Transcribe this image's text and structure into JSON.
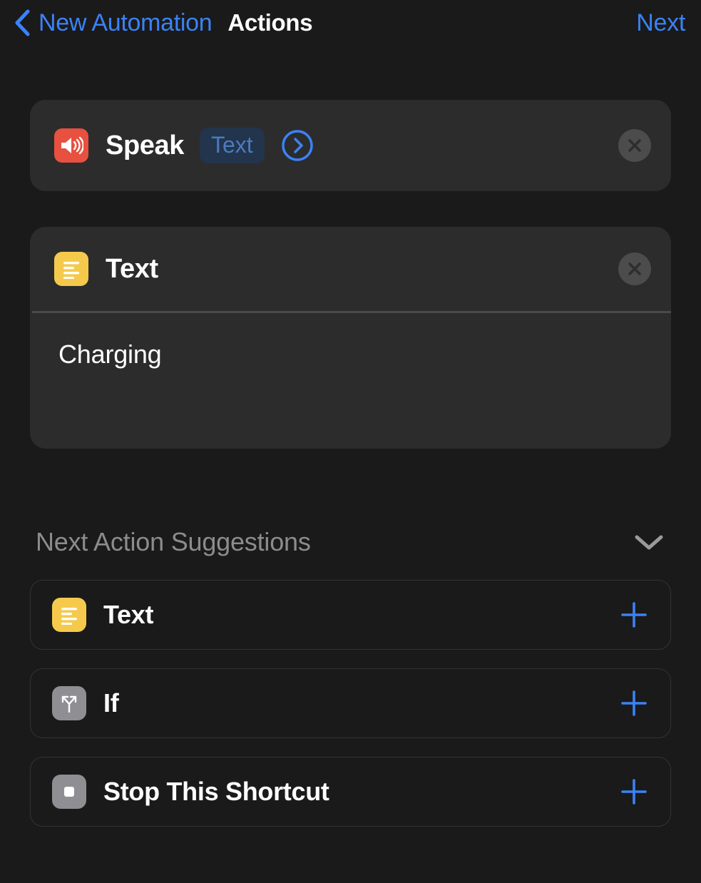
{
  "nav": {
    "back_label": "New Automation",
    "back_icon": "chevron-left-icon",
    "title": "Actions",
    "next_label": "Next"
  },
  "actions": [
    {
      "id": "speak",
      "title": "Speak",
      "icon": "speaker-wave-icon",
      "icon_color": "#e8503f",
      "variable_pill": "Text",
      "disclosure_icon": "chevron-right-circle-icon",
      "close_icon": "close-icon"
    },
    {
      "id": "text",
      "title": "Text",
      "icon": "text-lines-icon",
      "icon_color": "#f5ca4c",
      "value": "Charging",
      "close_icon": "close-icon"
    }
  ],
  "suggestions": {
    "header": "Next Action Suggestions",
    "collapse_icon": "chevron-down-icon",
    "items": [
      {
        "label": "Text",
        "icon": "text-lines-icon",
        "icon_color": "#f5ca4c",
        "add_icon": "plus-icon"
      },
      {
        "label": "If",
        "icon": "branch-arrows-icon",
        "icon_color": "#8e8e93",
        "add_icon": "plus-icon"
      },
      {
        "label": "Stop This Shortcut",
        "icon": "stop-square-icon",
        "icon_color": "#8e8e93",
        "add_icon": "plus-icon"
      }
    ]
  },
  "colors": {
    "accent_blue": "#3b82f6",
    "background": "#1a1a1a",
    "card_background": "#2c2c2c",
    "muted_text": "#8c8c8c",
    "pill_background": "#23344d",
    "pill_text": "#4a7bbd"
  }
}
